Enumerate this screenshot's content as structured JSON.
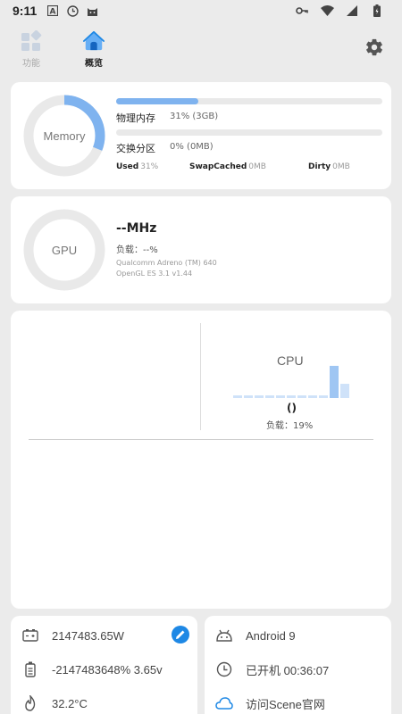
{
  "status_bar": {
    "time": "9:11",
    "left_icons": [
      "font-a-icon",
      "clock-icon",
      "cat-icon"
    ],
    "right_icons": [
      "vpn-key-icon",
      "wifi-icon",
      "signal-icon",
      "battery-charging-icon"
    ]
  },
  "nav": {
    "tabs": [
      {
        "label": "功能",
        "icon": "function-grid-icon",
        "active": false
      },
      {
        "label": "概览",
        "icon": "home-icon",
        "active": true
      }
    ],
    "settings_icon": "gear-icon"
  },
  "memory": {
    "ring_label": "Memory",
    "ring_percent": 0.31,
    "physical": {
      "label": "物理内存",
      "value": "31% (3GB)",
      "percent": 0.31
    },
    "swap": {
      "label": "交换分区",
      "value": "0% (0MB)",
      "percent": 0
    },
    "stats": [
      {
        "name": "Used",
        "value": "31%"
      },
      {
        "name": "SwapCached",
        "value": "0MB"
      },
      {
        "name": "Dirty",
        "value": "0MB"
      }
    ]
  },
  "gpu": {
    "ring_label": "GPU",
    "mhz": "--MHz",
    "load": "负载：--%",
    "renderer": "Qualcomm Adreno (TM) 640",
    "version": "OpenGL ES 3.1 v1.44"
  },
  "cpu": {
    "title": "CPU",
    "subtitle": "()",
    "load": "负载：19%",
    "core_levels": [
      0.05,
      0.05,
      0.05,
      0.05,
      0.05,
      0.05,
      0.05,
      0.05,
      0.05,
      0.95,
      0.42
    ]
  },
  "device_info": {
    "left": [
      {
        "icon": "battery-icon",
        "text": "2147483.65W"
      },
      {
        "icon": "battery-level-icon",
        "text": "-2147483648%  3.65v"
      },
      {
        "icon": "temperature-icon",
        "text": "32.2°C"
      }
    ],
    "edit_icon": "edit-icon",
    "right": [
      {
        "icon": "android-icon",
        "text": "Android 9"
      },
      {
        "icon": "clock-icon",
        "text": "已开机  00:36:07"
      },
      {
        "icon": "cloud-icon",
        "text": "访问Scene官网"
      }
    ]
  },
  "colors": {
    "accent": "#7fb3ef",
    "accent_dark": "#1e88e5",
    "track": "#e9e9e9",
    "background": "#ebebeb"
  }
}
